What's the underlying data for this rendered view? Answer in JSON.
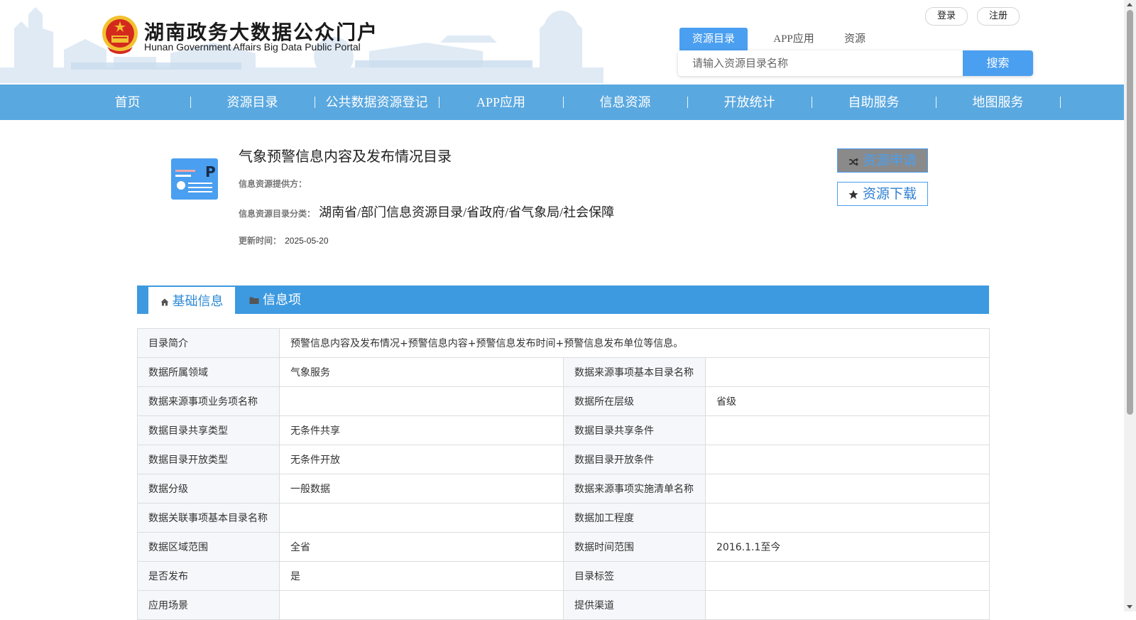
{
  "header": {
    "site_name_cn": "湖南政务大数据公众门户",
    "site_name_en": "Hunan Government Affairs Big Data Public Portal",
    "login_label": "登录",
    "register_label": "注册",
    "search_tabs": [
      "资源目录",
      "APP应用",
      "资源"
    ],
    "search_placeholder": "请输入资源目录名称",
    "search_button": "搜索"
  },
  "nav": {
    "items": [
      "首页",
      "资源目录",
      "公共数据资源登记",
      "APP应用",
      "信息资源",
      "开放统计",
      "自助服务",
      "地图服务"
    ]
  },
  "resource": {
    "title": "气象预警信息内容及发布情况目录",
    "provider_label": "信息资源提供方：",
    "provider_value": "",
    "category_label": "信息资源目录分类：",
    "category_value": "湖南省/部门信息资源目录/省政府/省气象局/社会保障",
    "updated_label": "更新时间：",
    "updated_value": "2025-05-20",
    "apply_button": "资源申请",
    "download_button": "资源下载"
  },
  "tabs": {
    "basic_info": "基础信息",
    "info_items": "信息项"
  },
  "table": {
    "summary_label": "目录简介",
    "summary_value": "预警信息内容及发布情况+预警信息内容+预警信息发布时间+预警信息发布单位等信息。",
    "rows": [
      [
        "数据所属领域",
        "气象服务",
        "数据来源事项基本目录名称",
        ""
      ],
      [
        "数据来源事项业务项名称",
        "",
        "数据所在层级",
        "省级"
      ],
      [
        "数据目录共享类型",
        "无条件共享",
        "数据目录共享条件",
        ""
      ],
      [
        "数据目录开放类型",
        "无条件开放",
        "数据目录开放条件",
        ""
      ],
      [
        "数据分级",
        "一般数据",
        "数据来源事项实施清单名称",
        ""
      ],
      [
        "数据关联事项基本目录名称",
        "",
        "数据加工程度",
        ""
      ],
      [
        "数据区域范围",
        "全省",
        "数据时间范围",
        "2016.1.1至今"
      ],
      [
        "是否发布",
        "是",
        "目录标签",
        ""
      ],
      [
        "应用场景",
        "",
        "提供渠道",
        ""
      ]
    ]
  },
  "colors": {
    "nav_bg": "#5aa8e0",
    "tab_bar_bg": "#3d9ae0",
    "accent": "#4a9ff0",
    "emblem_red": "#d42a1e",
    "emblem_gold": "#f2c230"
  }
}
